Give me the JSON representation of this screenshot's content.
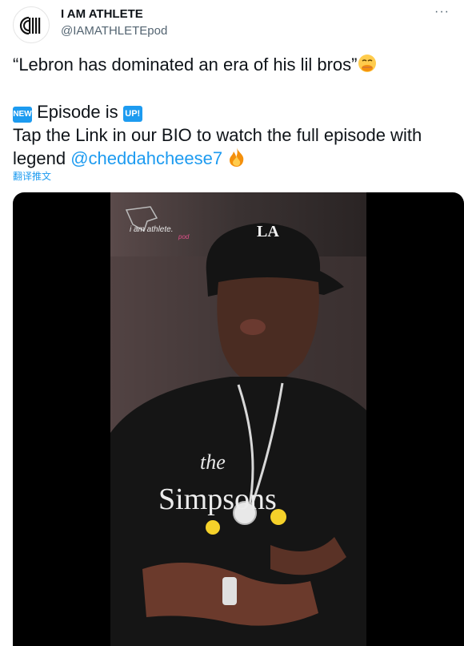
{
  "account": {
    "name": "I AM ATHLETE",
    "handle": "@IAMATHLETEpod",
    "more_icon": "more-horizontal-icon"
  },
  "tweet": {
    "quote": "“Lebron has dominated an era of his lil bros”",
    "quote_emoji": "hand-over-mouth-emoji",
    "new_badge": "NEW",
    "episode_text": "Episode is",
    "up_badge": "UP!",
    "tap_text": "Tap the Link in our BIO to watch the full episode with",
    "legend_text": "legend",
    "mention": "@cheddahcheese7",
    "fire_emoji": "fire-emoji"
  },
  "translate": {
    "label": "翻译推文"
  },
  "media": {
    "watermark": "i am athlete.",
    "watermark_sub": "pod",
    "cap_logo": "LA",
    "shirt_text_top": "the",
    "shirt_text_main": "Simpsons"
  },
  "colors": {
    "link": "#1d9bf0",
    "secondary_text": "#536471",
    "text": "#0f1419",
    "media_bg": "#000000"
  }
}
